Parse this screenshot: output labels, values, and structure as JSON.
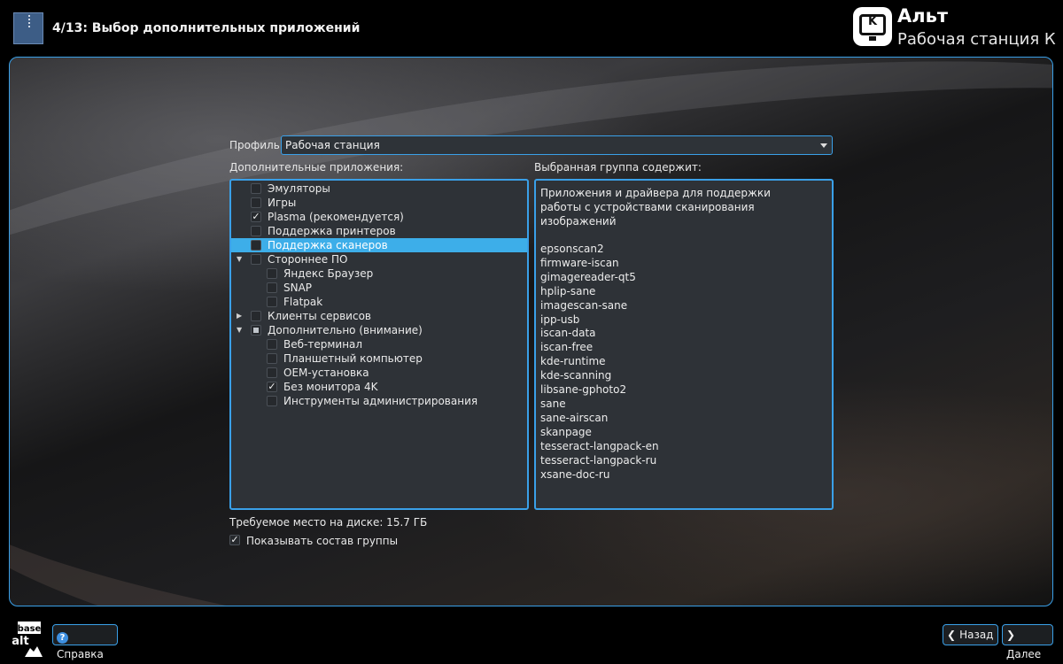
{
  "header": {
    "step_title": "4/13: Выбор дополнительных приложений",
    "brand_line1": "Альт",
    "brand_line2": "Рабочая станция К",
    "logo_letter": "K"
  },
  "profile": {
    "label": "Профиль:",
    "selected": "Рабочая станция"
  },
  "apps_label": "Дополнительные приложения:",
  "group_label": "Выбранная группа содержит:",
  "tree": [
    {
      "label": "Эмуляторы",
      "level": 0,
      "checked": "none",
      "expander": "",
      "selected": false
    },
    {
      "label": "Игры",
      "level": 0,
      "checked": "none",
      "expander": "",
      "selected": false
    },
    {
      "label": "Plasma (рекомендуется)",
      "level": 0,
      "checked": "checked",
      "expander": "",
      "selected": false
    },
    {
      "label": "Поддержка принтеров",
      "level": 0,
      "checked": "none",
      "expander": "",
      "selected": false
    },
    {
      "label": "Поддержка сканеров",
      "level": 0,
      "checked": "none",
      "expander": "",
      "selected": true
    },
    {
      "label": "Стороннее ПО",
      "level": 0,
      "checked": "none",
      "expander": "expanded",
      "selected": false
    },
    {
      "label": "Яндекс Браузер",
      "level": 1,
      "checked": "none",
      "expander": "",
      "selected": false
    },
    {
      "label": "SNAP",
      "level": 1,
      "checked": "none",
      "expander": "",
      "selected": false
    },
    {
      "label": "Flatpak",
      "level": 1,
      "checked": "none",
      "expander": "",
      "selected": false
    },
    {
      "label": "Клиенты сервисов",
      "level": 0,
      "checked": "none",
      "expander": "collapsed",
      "selected": false
    },
    {
      "label": "Дополнительно (внимание)",
      "level": 0,
      "checked": "partial",
      "expander": "expanded",
      "selected": false
    },
    {
      "label": "Веб-терминал",
      "level": 1,
      "checked": "none",
      "expander": "",
      "selected": false
    },
    {
      "label": "Планшетный компьютер",
      "level": 1,
      "checked": "none",
      "expander": "",
      "selected": false
    },
    {
      "label": "OEM-установка",
      "level": 1,
      "checked": "none",
      "expander": "",
      "selected": false
    },
    {
      "label": "Без монитора 4K",
      "level": 1,
      "checked": "checked",
      "expander": "",
      "selected": false
    },
    {
      "label": "Инструменты администрирования",
      "level": 1,
      "checked": "none",
      "expander": "",
      "selected": false
    }
  ],
  "group": {
    "description": "Приложения и драйвера для поддержки работы с устройствами сканирования изображений",
    "packages": [
      "epsonscan2",
      "firmware-iscan",
      "gimagereader-qt5",
      "hplip-sane",
      "imagescan-sane",
      "ipp-usb",
      "iscan-data",
      "iscan-free",
      "kde-runtime",
      "kde-scanning",
      "libsane-gphoto2",
      "sane",
      "sane-airscan",
      "skanpage",
      "tesseract-langpack-en",
      "tesseract-langpack-ru",
      "xsane-doc-ru"
    ]
  },
  "disk_space": "Требуемое место на диске: 15.7 ГБ",
  "show_group": {
    "label": "Показывать состав группы",
    "checked": true
  },
  "footer": {
    "basealt_top": "base",
    "basealt_bottom": "alt",
    "help_label": "Справка",
    "back_label": "Назад",
    "next_label": "Далее"
  },
  "colors": {
    "accent": "#3daee9",
    "panel": "#2e3237",
    "selection": "#3daee9"
  }
}
